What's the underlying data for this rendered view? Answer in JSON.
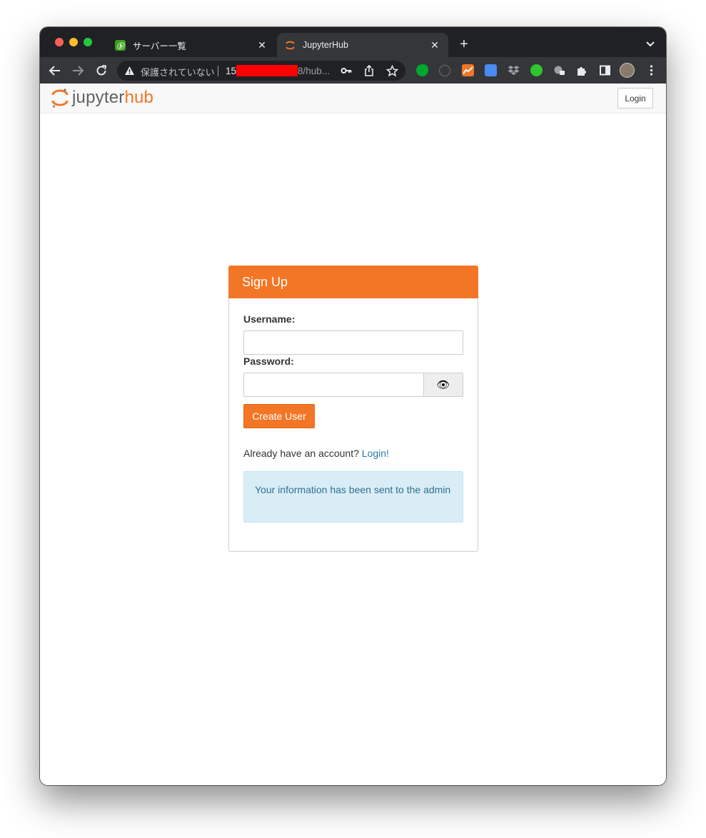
{
  "browser": {
    "tabs": [
      {
        "title": "サーバー一覧",
        "favicon": "green-leaf-favicon",
        "active": false
      },
      {
        "title": "JupyterHub",
        "favicon": "jupyter-favicon",
        "active": true
      }
    ],
    "new_tab_label": "+",
    "omnibox": {
      "security_label": "保護されていない",
      "url_prefix": "15",
      "url_suffix": "8/hub..."
    }
  },
  "navbar": {
    "brand_part1": "jupyter",
    "brand_part2": "hub",
    "login_label": "Login"
  },
  "signup": {
    "heading": "Sign Up",
    "username_label": "Username:",
    "username_value": "",
    "password_label": "Password:",
    "password_value": "",
    "show_password_icon": "👁",
    "submit_label": "Create User",
    "already_text": "Already have an account?",
    "login_link": "Login!",
    "alert_text": "Your information has been sent to the admin"
  },
  "colors": {
    "accent": "#f37626",
    "alert_bg": "#d9edf7",
    "alert_text": "#31708f",
    "link": "#2a7ab0"
  }
}
